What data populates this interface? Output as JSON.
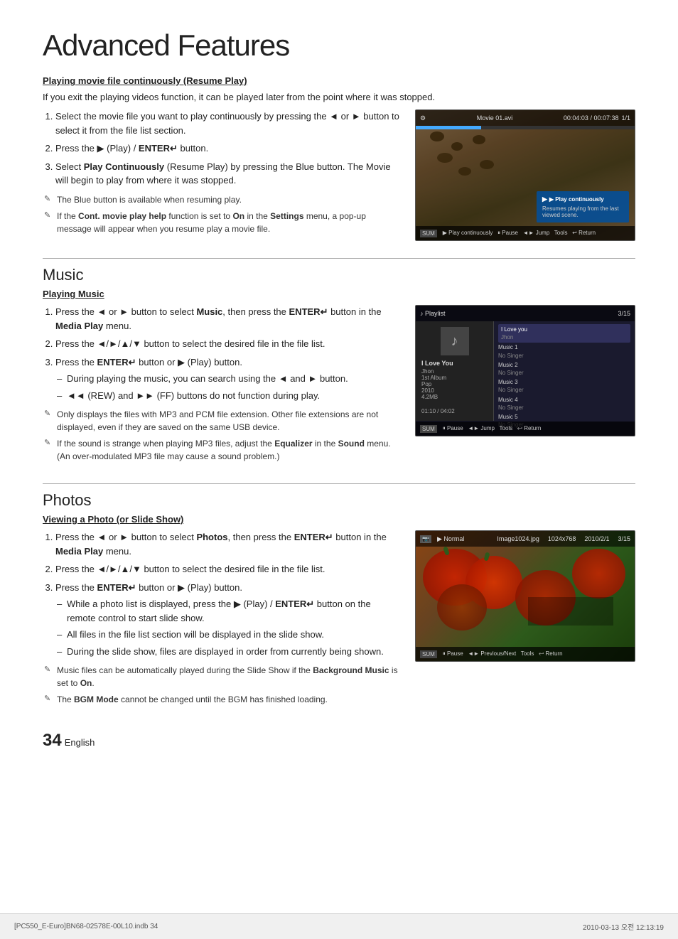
{
  "page": {
    "title": "Advanced Features",
    "page_number": "34",
    "page_label": "English"
  },
  "footer": {
    "left": "[PC550_E-Euro]BN68-02578E-00L10.indb   34",
    "right": "2010-03-13   오전 12:13:19"
  },
  "movie_section": {
    "sub_heading": "Playing movie file continuously (Resume Play)",
    "intro": "If you exit the playing videos function, it can be played later from the point where it was stopped.",
    "steps": [
      "Select the movie file you want to play continuously by pressing the ◄ or ► button to select it from the file list section.",
      "Press the ▶ (Play) / ENTER↵ button.",
      "Select Play Continuously (Resume Play) by pressing the Blue button. The Movie will begin to play from where it was stopped."
    ],
    "notes": [
      "The Blue button is available when resuming play.",
      "If the Cont. movie play help function is set to On in the Settings menu, a pop-up message will appear when you resume play a movie file."
    ],
    "screen": {
      "time": "00:04:03 / 00:07:38",
      "filename": "Movie 01.avi",
      "page": "1/1",
      "overlay_title": "▶ Play continuously",
      "overlay_text": "Resumes playing from the last viewed scene.",
      "bottom_bar": "▶ Play continuously   ⏸ Pause   ◄► Jump   🔧 Tools   ↩ Return"
    }
  },
  "music_section": {
    "title": "Music",
    "sub_heading": "Playing Music",
    "steps": [
      "Press the ◄ or ► button to select Music, then press the ENTER↵ button in the Media Play menu.",
      "Press the ◄/►/▲/▼ button to select the desired file in the file list.",
      "Press the ENTER↵ button or ▶ (Play) button."
    ],
    "dash_items": [
      "During playing the music, you can search using the ◄ and ► button.",
      "◄◄ (REW) and ►► (FF) buttons do not function during play."
    ],
    "notes": [
      "Only displays the files with MP3 and PCM file extension. Other file extensions are not displayed, even if they are saved on the same USB device.",
      "If the sound is strange when playing MP3 files, adjust the Equalizer in the Sound menu. (An over-modulated MP3 file may cause a sound problem.)"
    ],
    "screen": {
      "playlist_label": "♪ Playlist",
      "page": "3/15",
      "selected_title": "I Love You",
      "selected_artist": "Jhon",
      "album": "1st Album",
      "genre": "Pop",
      "year": "2010",
      "size": "4.2MB",
      "time": "01:10 / 04:02",
      "tracks": [
        {
          "name": "I Love you",
          "singer": "Jhon",
          "active": true
        },
        {
          "name": "Music 1",
          "singer": "No Singer"
        },
        {
          "name": "Music 2",
          "singer": "No Singer"
        },
        {
          "name": "Music 3",
          "singer": "No Singer"
        },
        {
          "name": "Music 4",
          "singer": "No Singer"
        },
        {
          "name": "Music 5",
          "singer": "No Singer"
        }
      ],
      "bottom_bar": "⏸ Pause   ◄► Jump   🔧 Tools   ↩ Return"
    }
  },
  "photos_section": {
    "title": "Photos",
    "sub_heading": "Viewing a Photo (or Slide Show)",
    "steps": [
      "Press the ◄ or ► button to select Photos, then press the ENTER↵ button in the Media Play menu.",
      "Press the ◄/►/▲/▼ button to select the desired file in the file list.",
      "Press the ENTER↵ button or ▶ (Play) button."
    ],
    "dash_items": [
      "While a photo list is displayed, press the ▶ (Play) / ENTER↵ button on the remote control to start slide show.",
      "All files in the file list section will be displayed in the slide show.",
      "During the slide show, files are displayed in order from currently being shown."
    ],
    "notes": [
      "Music files can be automatically played during the Slide Show if the Background Music is set to On.",
      "The BGM Mode cannot be changed until the BGM has finished loading."
    ],
    "screen": {
      "mode": "▶ Normal",
      "filename": "Image1024.jpg",
      "resolution": "1024x768",
      "date": "2010/2/1",
      "page": "3/15",
      "bottom_bar": "⏸ Pause   ◄► Previous/Next   🔧 Tools   ↩ Return"
    }
  }
}
